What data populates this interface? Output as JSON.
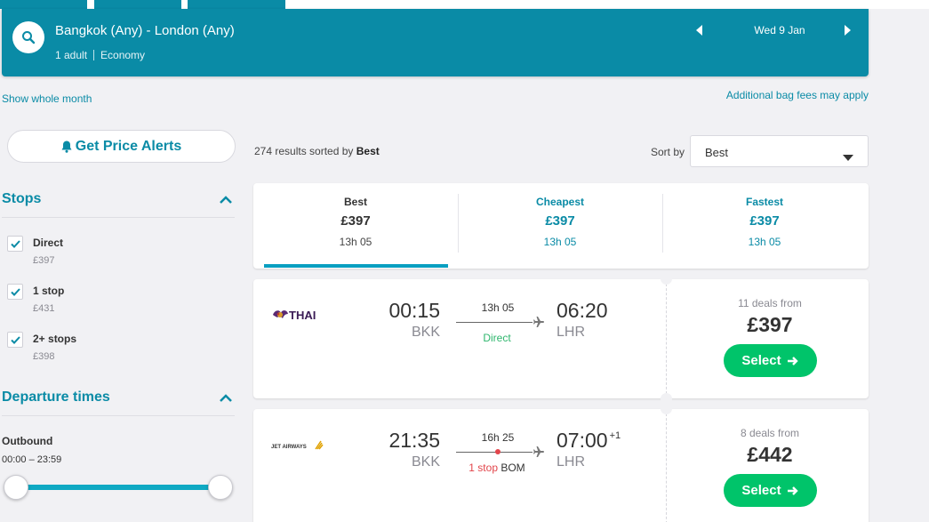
{
  "search": {
    "route": "Bangkok (Any) - London (Any)",
    "passengers": "1 adult",
    "cabin": "Economy",
    "date": "Wed 9 Jan"
  },
  "links": {
    "show_month": "Show whole month",
    "bag_fees": "Additional bag fees may apply"
  },
  "sidebar": {
    "alerts_label": "Get Price Alerts",
    "stops_title": "Stops",
    "stops": [
      {
        "label": "Direct",
        "price": "£397",
        "checked": true
      },
      {
        "label": "1 stop",
        "price": "£431",
        "checked": true
      },
      {
        "label": "2+ stops",
        "price": "£398",
        "checked": true
      }
    ],
    "departure_title": "Departure times",
    "outbound_label": "Outbound",
    "outbound_range": "00:00 – 23:59"
  },
  "results": {
    "count_text": "274 results sorted by",
    "sorted_by": "Best",
    "sort_label": "Sort by",
    "sort_value": "Best"
  },
  "sort_tabs": [
    {
      "name": "Best",
      "price": "£397",
      "duration": "13h 05",
      "active": true
    },
    {
      "name": "Cheapest",
      "price": "£397",
      "duration": "13h 05",
      "active": false
    },
    {
      "name": "Fastest",
      "price": "£397",
      "duration": "13h 05",
      "active": false
    }
  ],
  "flights": [
    {
      "airline": "THAI",
      "dep_time": "00:15",
      "dep_code": "BKK",
      "arr_time": "06:20",
      "arr_code": "LHR",
      "duration": "13h 05",
      "stops": "Direct",
      "deals": "11 deals from",
      "price": "£397",
      "select_label": "Select"
    },
    {
      "airline": "JET AIRWAYS",
      "dep_time": "21:35",
      "dep_code": "BKK",
      "arr_time": "07:00",
      "arr_day_offset": "+1",
      "arr_code": "LHR",
      "duration": "16h 25",
      "stops": "1 stop",
      "via": "BOM",
      "deals": "8 deals from",
      "price": "£442",
      "select_label": "Select"
    }
  ],
  "colors": {
    "primary": "#0a8ba6",
    "select": "#00c46a",
    "stop_red": "#e2454b",
    "direct_green": "#2eb66d"
  }
}
